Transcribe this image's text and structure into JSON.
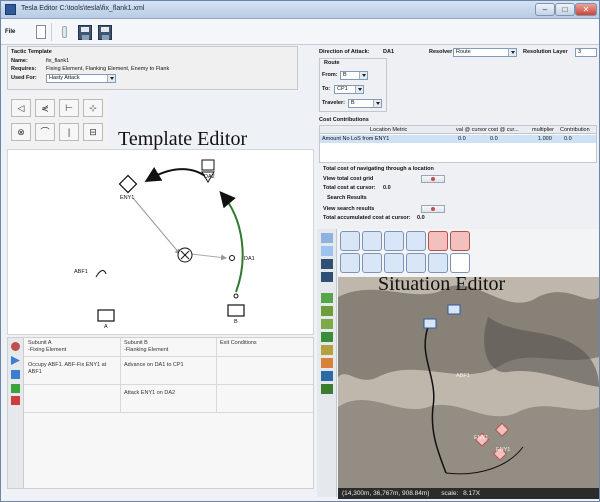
{
  "window": {
    "title": "Tesla Editor C:\\tools\\tesla\\fix_flank1.xml"
  },
  "toolbar": {
    "file_label": "File"
  },
  "tactic": {
    "header": "Tactic Template",
    "name_label": "Name:",
    "name_value": "fix_flank1",
    "requires_label": "Requires:",
    "requires_value": "Fixing Element, Flanking Element, Enemy to Flank",
    "used_for_label": "Used For:",
    "used_for_value": "Hasty Attack"
  },
  "template_tools": {
    "row1": [
      "◁",
      "⋞",
      "⊢",
      "⊹"
    ],
    "row2": [
      "⊗",
      "⌒",
      "|",
      "⊟"
    ]
  },
  "template_canvas": {
    "overlay_label": "Template Editor",
    "units": [
      {
        "id": "DA2"
      },
      {
        "id": "ENY1"
      },
      {
        "id": "DA1"
      },
      {
        "id": "ABF1"
      },
      {
        "id": "A"
      },
      {
        "id": "B"
      }
    ]
  },
  "subunits": {
    "columns": [
      "Subunit A\n-Fixing Element",
      "Subunit B\n-Flanking Element",
      "Exit Conditions"
    ],
    "rows": [
      [
        "Occupy ABF1. ABF-Fix ENY1 at ABF1",
        "Advance on DA1 to CP1",
        ""
      ],
      [
        "",
        "Attack ENY1 on DA2",
        ""
      ]
    ]
  },
  "direction": {
    "label": "Direction of Attack:",
    "value": "DA1",
    "resolver_label": "Resolver",
    "resolver_value": "Route",
    "resolution_label": "Resolution Layer",
    "resolution_value": "3"
  },
  "route": {
    "header": "Route",
    "from_label": "From:",
    "from_value": "B",
    "to_label": "To:",
    "to_value": "CP1",
    "traveler_label": "Traveler:",
    "traveler_value": "B"
  },
  "cost": {
    "header": "Cost Contributions",
    "columns": [
      "Location Metric",
      "val @ cursor",
      "cost @ cur...",
      "multiplier",
      "Contribution"
    ],
    "row": [
      "Amount No LoS from ENY1",
      "0.0",
      "0.0",
      "1.000",
      "0.0"
    ],
    "total_header": "Total cost of navigating through a location",
    "view_grid_label": "View total cost grid",
    "total_at_cursor_label": "Total cost at cursor:",
    "total_at_cursor_value": "0.0",
    "search_header": "Search Results",
    "view_search_label": "View search results",
    "accumulated_label": "Total accumulated cost at cursor:",
    "accumulated_value": "0.0"
  },
  "situation": {
    "overlay_label": "Situation Editor",
    "map_units": [
      "ABF1",
      "ENY1",
      "ENY1"
    ],
    "status_coords": "(14,300m, 36,767m, 908.84m)",
    "status_scale_label": "scale:",
    "status_scale_value": "8.17X"
  },
  "colors": {
    "accent": "#c0504d",
    "selected_row": "#cfe1f7",
    "sym_blue": "#d9e6f7"
  }
}
